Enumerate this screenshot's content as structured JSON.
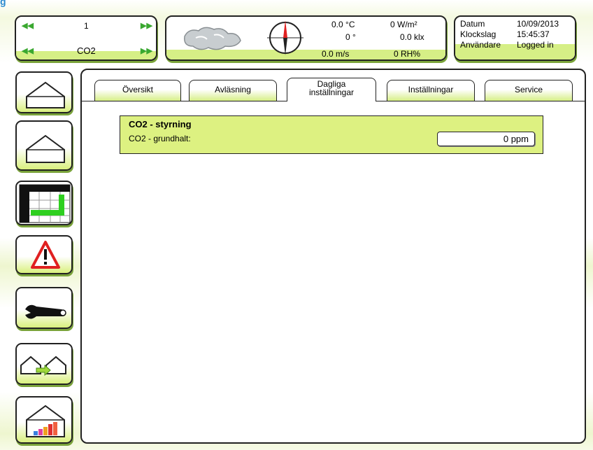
{
  "window": {
    "corner_glyph": "g"
  },
  "selector": {
    "row1_value": "1",
    "row2_value": "CO2"
  },
  "weather": {
    "temperature": "0.0 °C",
    "direction": "0 °",
    "wind_speed": "0.0 m/s",
    "radiation": "0 W/m²",
    "light": "0.0 klx",
    "humidity": "0 RH%"
  },
  "info": {
    "date_label": "Datum",
    "date_value": "10/09/2013",
    "time_label": "Klockslag",
    "time_value": "15:45:37",
    "user_label": "Användare",
    "user_value": "Logged in"
  },
  "tabs": [
    {
      "label": "Översikt"
    },
    {
      "label": "Avläsning"
    },
    {
      "label": "Dagliga inställningar",
      "line1": "Dagliga",
      "line2": "inställningar"
    },
    {
      "label": "Inställningar"
    },
    {
      "label": "Service"
    }
  ],
  "content": {
    "group_title": "CO2 - styrning",
    "setting_label": "CO2 - grundhalt:",
    "setting_value": "0 ppm"
  },
  "icons": {
    "nav": [
      "greenhouse-icon",
      "greenhouse-icon",
      "chart-grid-icon",
      "warning-icon",
      "wrench-icon",
      "greenhouse-transfer-icon",
      "greenhouse-energy-icon"
    ],
    "selector_arrows": [
      "first-arrow-icon",
      "last-arrow-icon"
    ],
    "weather": [
      "cloud-icon",
      "compass-icon"
    ]
  },
  "colors": {
    "accent_green": "#d6ef86",
    "compass_needle": "#e02020",
    "text": "#000000"
  }
}
